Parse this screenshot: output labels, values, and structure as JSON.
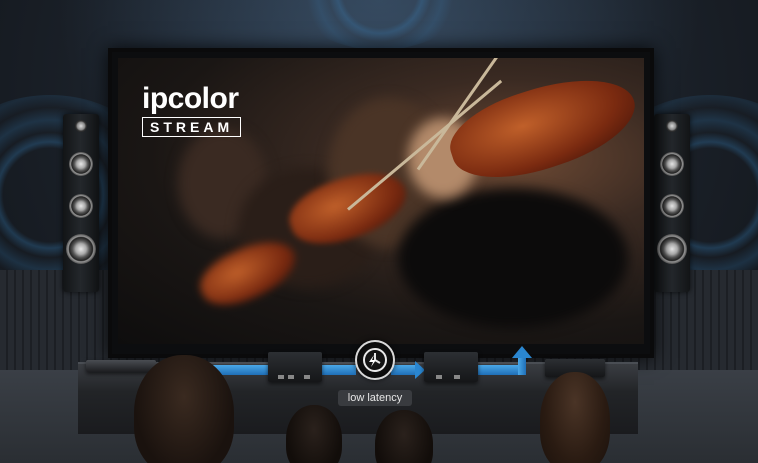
{
  "brand": {
    "name": "ipcolor",
    "product": "STREAM"
  },
  "signal_path": {
    "badge_label": "low latency",
    "icon": "clock-lightning-icon",
    "arrow_color": "#2a86d0"
  },
  "screen_content": "violinists-image",
  "colors": {
    "accent": "#2a86d0",
    "logo": "#ffffff"
  }
}
